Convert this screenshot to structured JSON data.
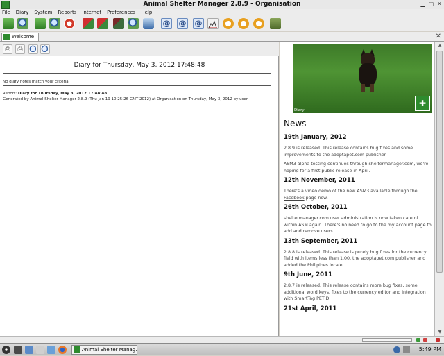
{
  "window": {
    "title": "Animal Shelter Manager 2.8.9 - Organisation"
  },
  "menu": [
    "File",
    "Diary",
    "System",
    "Reports",
    "Internet",
    "Preferences",
    "Help"
  ],
  "toolbar": {
    "icons": [
      "add-animal-icon",
      "find-animal-icon",
      "add-person-icon",
      "find-person-icon",
      "lost-found-icon",
      "add-waiting-icon",
      "find-waiting-icon",
      "add-lost-icon",
      "find-found-icon",
      "movement-icon",
      "email-icon",
      "email-icon",
      "email-icon",
      "chart-icon",
      "clock-icon",
      "clock-icon",
      "clock-icon",
      "calculator-icon"
    ]
  },
  "tab": {
    "label": "Welcome"
  },
  "diary": {
    "title": "Diary for Thursday, May 3, 2012 17:48:48",
    "no_match": "No diary notes match your criteria.",
    "report_prefix": "Report: ",
    "report_bold": "Diary for Thursday, May 3, 2012 17:48:48",
    "generated": "Generated by Animal Shelter Manager 2.8.9 (Thu Jan 19 10:25:26 GMT 2012) at Organisation on Thursday, May 3, 2012 by user"
  },
  "photo": {
    "caption": "Diary"
  },
  "news": {
    "heading": "News",
    "items": [
      {
        "date": "19th January, 2012",
        "paras": [
          "2.8.9 is released. This release contains bug fixes and some improvements to the adoptapet.com publisher.",
          "ASM3 alpha testing continues through sheltermanager.com, we're hoping for a first public release in April."
        ]
      },
      {
        "date": "12th November, 2011",
        "paras": [
          "There's a video demo of the new ASM3 available through the ",
          "Facebook",
          " page now."
        ]
      },
      {
        "date": "26th October, 2011",
        "paras": [
          "sheltermanager.com user administration is now taken care of within ASM again. There's no need to go to the my account page to add and remove users."
        ]
      },
      {
        "date": "13th September, 2011",
        "paras": [
          "2.8.8 is released. This release is purely bug fixes for the currency field with items less than 1.00, the adoptapet.com publisher and added the Philipines locale."
        ]
      },
      {
        "date": "9th June, 2011",
        "paras": [
          "2.8.7 is released. This release contains more bug fixes, some additional word keys, fixes to the currency editor and integration with SmartTag PETID"
        ]
      },
      {
        "date": "21st April, 2011",
        "paras": []
      }
    ]
  },
  "taskbar": {
    "task_label": "Animal Shelter Manag...",
    "clock": "5:49 PM"
  }
}
